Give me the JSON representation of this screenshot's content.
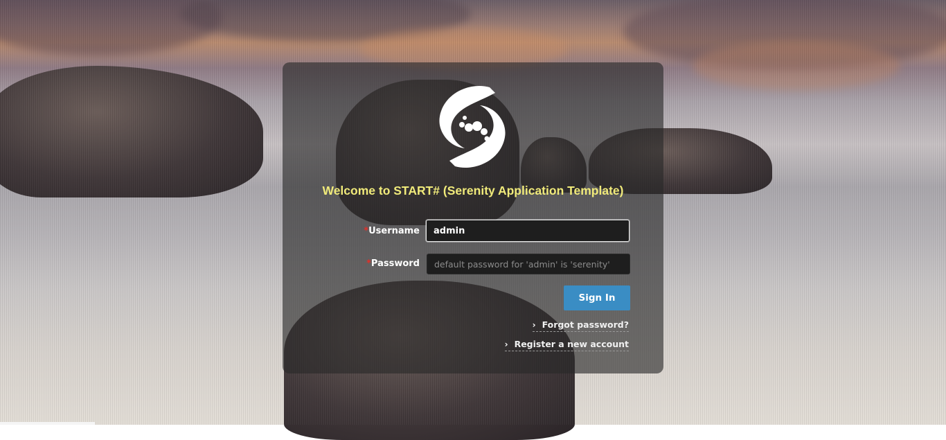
{
  "login": {
    "welcome_title": "Welcome to START# (Serenity Application Template)",
    "username": {
      "required_mark": "*",
      "label": "Username",
      "value": "admin"
    },
    "password": {
      "required_mark": "*",
      "label": "Password",
      "placeholder": "default password for 'admin' is 'serenity'"
    },
    "sign_in_label": "Sign In",
    "forgot_password_label": "Forgot password?",
    "register_label": "Register a new account",
    "link_chevron": "›"
  },
  "icons": {
    "logo": "serenity-swirl-logo",
    "link_chevron": "chevron-right-icon"
  },
  "colors": {
    "welcome_text": "#f0ea7a",
    "primary_button": "#3a8dc4",
    "required_mark": "#e0302a",
    "panel_background": "rgba(40,40,40,0.62)"
  }
}
